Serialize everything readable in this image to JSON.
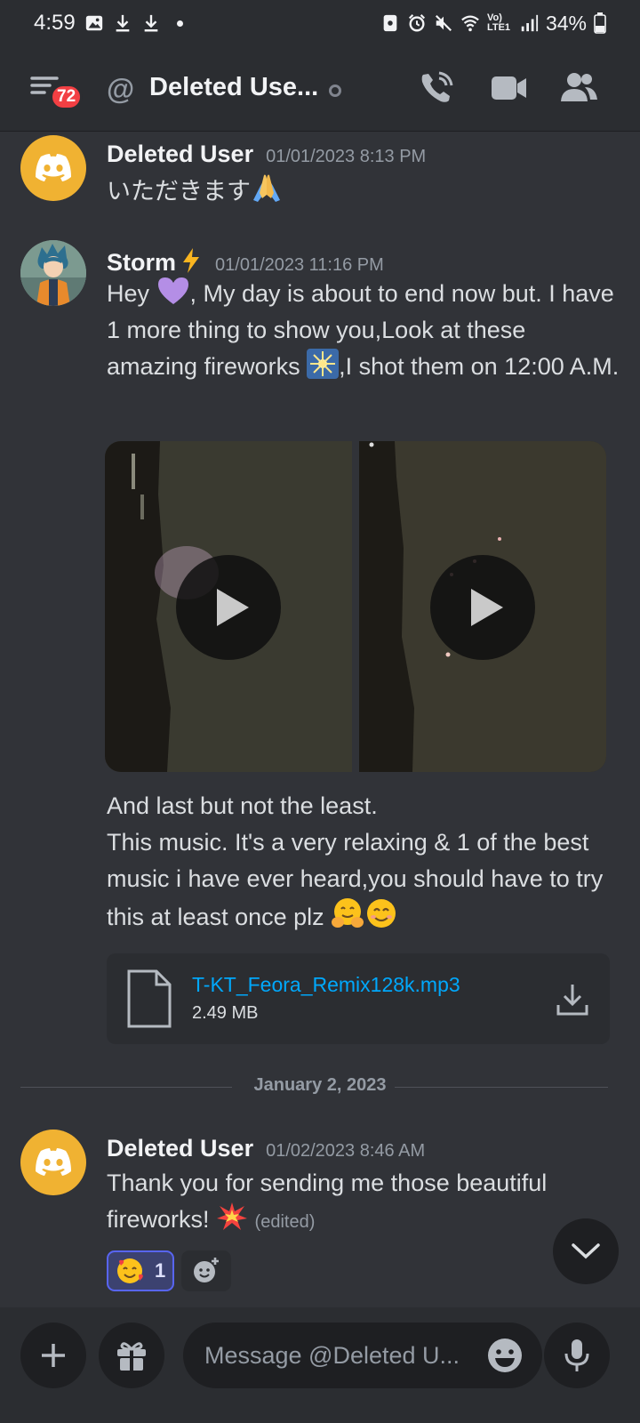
{
  "status_bar": {
    "time": "4:59",
    "battery": "34%",
    "network": "Vo) LTE1"
  },
  "header": {
    "badge_count": "72",
    "title": "Deleted Use...",
    "at_symbol": "@"
  },
  "messages": [
    {
      "author": "Deleted User",
      "timestamp": "01/01/2023 8:13 PM",
      "text": "いただきます"
    },
    {
      "author": "Storm",
      "timestamp": "01/01/2023 11:16 PM",
      "text_parts": [
        "Hey ",
        ", My day is about to end now but. I have 1 more thing to show you,Look at these amazing fireworks ",
        ",I shot them on 12:00 A.M."
      ],
      "text2_line1": "And last but not the least.",
      "text2_line2": "This music. It's a very relaxing & 1 of the best music i have ever heard,you should have to try this at least once plz ",
      "attachment": {
        "file_name": "T-KT_Feora_Remix128k.mp3",
        "file_size": "2.49 MB"
      }
    },
    {
      "author": "Deleted User",
      "timestamp": "01/02/2023 8:46 AM",
      "text": "Thank you for sending me those beautiful fireworks! ",
      "edited": "(edited)",
      "reaction_count": "1"
    }
  ],
  "date_divider": "January 2, 2023",
  "composer": {
    "placeholder": "Message @Deleted U..."
  },
  "colors": {
    "background": "#313338",
    "header": "#2b2d31",
    "link": "#00a8fc",
    "badge": "#f23f43",
    "discord_avatar": "#f0b232"
  }
}
